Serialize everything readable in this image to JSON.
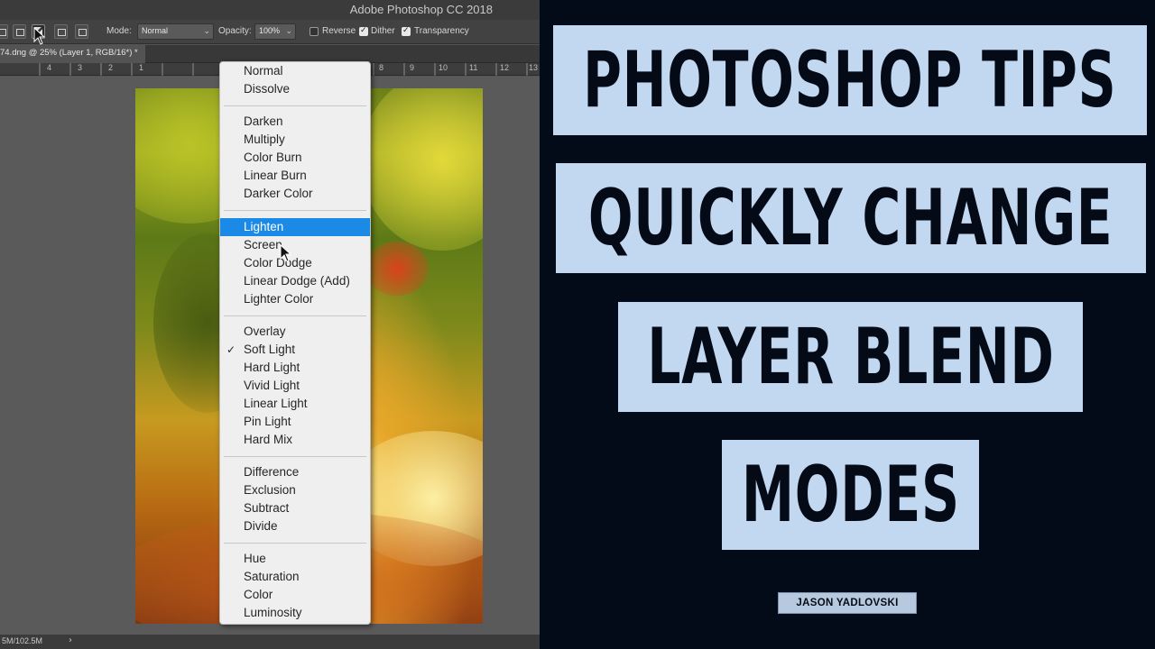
{
  "app": {
    "title": "Adobe Photoshop CC 2018",
    "document_tab": "74.dng @ 25% (Layer 1, RGB/16*) *",
    "status": "5M/102.5M",
    "status_arrow": "›"
  },
  "options_bar": {
    "mode_label": "Mode:",
    "mode_value": "Normal",
    "opacity_label": "Opacity:",
    "opacity_value": "100%",
    "reverse_label": "Reverse",
    "reverse_checked": false,
    "dither_label": "Dither",
    "dither_checked": true,
    "transparency_label": "Transparency",
    "transparency_checked": true
  },
  "ruler": {
    "labels": [
      "4",
      "3",
      "2",
      "1",
      "8",
      "9",
      "10",
      "11",
      "12",
      "13"
    ]
  },
  "blend_menu": {
    "groups": [
      {
        "items": [
          "Normal",
          "Dissolve"
        ]
      },
      {
        "items": [
          "Darken",
          "Multiply",
          "Color Burn",
          "Linear Burn",
          "Darker Color"
        ]
      },
      {
        "items": [
          "Lighten",
          "Screen",
          "Color Dodge",
          "Linear Dodge (Add)",
          "Lighter Color"
        ]
      },
      {
        "items": [
          "Overlay",
          "Soft Light",
          "Hard Light",
          "Vivid Light",
          "Linear Light",
          "Pin Light",
          "Hard Mix"
        ]
      },
      {
        "items": [
          "Difference",
          "Exclusion",
          "Subtract",
          "Divide"
        ]
      },
      {
        "items": [
          "Hue",
          "Saturation",
          "Color",
          "Luminosity"
        ]
      }
    ],
    "highlighted": "Lighten",
    "checked": "Soft Light"
  },
  "banners": {
    "line1": "PHOTOSHOP TIPS",
    "line2": "QUICKLY CHANGE",
    "line3": "LAYER BLEND",
    "line4": "MODES"
  },
  "author": "JASON YADLOVSKI",
  "colors": {
    "background": "#040b18",
    "banner": "#c2d8f1",
    "banner_text": "#050b16",
    "menu_highlight": "#1a8ae6"
  }
}
